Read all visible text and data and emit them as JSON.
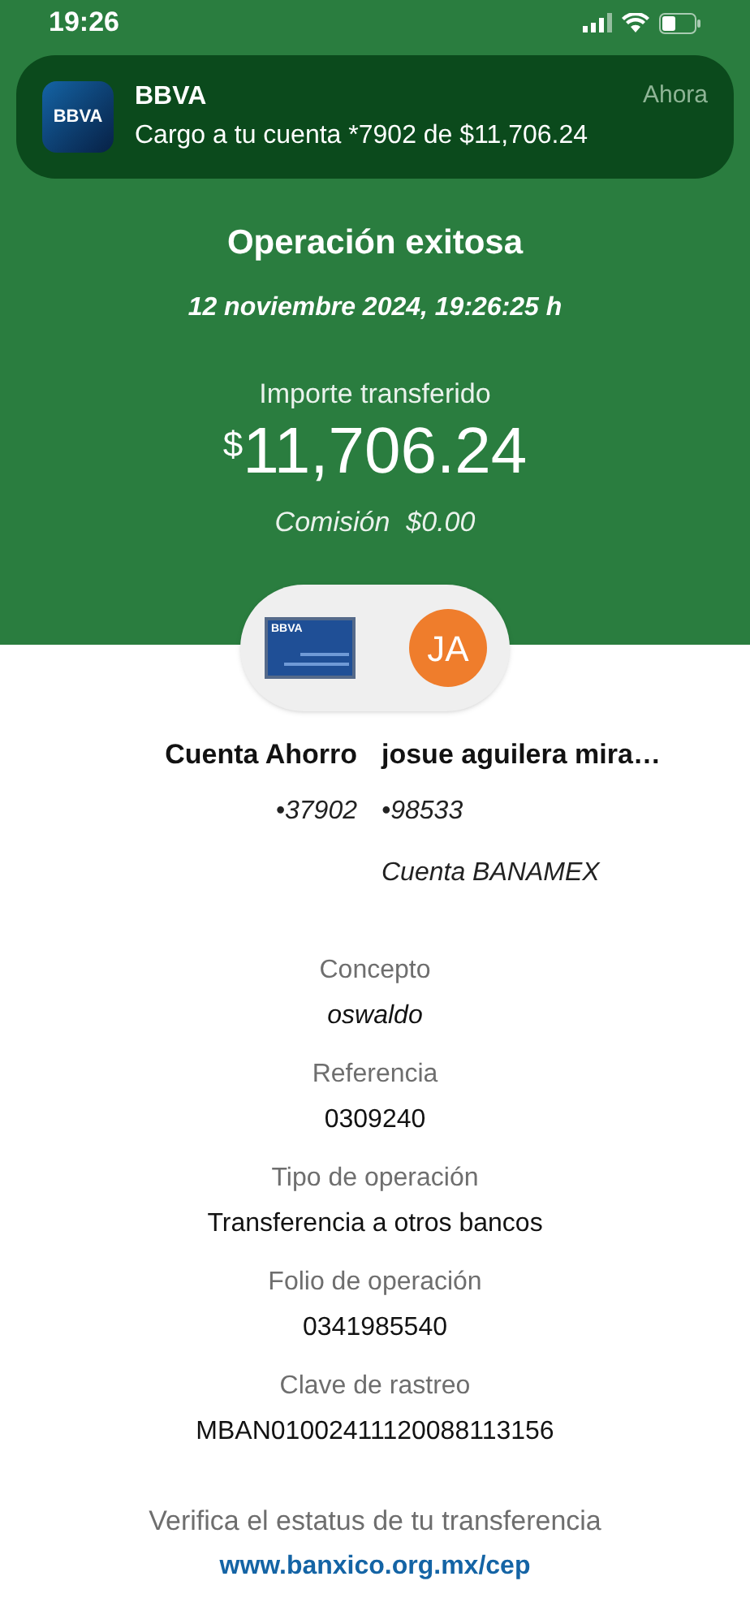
{
  "status_bar": {
    "time": "19:26"
  },
  "notification": {
    "app": "BBVA",
    "time": "Ahora",
    "message": "Cargo a tu cuenta *7902 de $11,706.24",
    "icon_text": "BBVA"
  },
  "header": {
    "title": "Operación exitosa",
    "datetime": "12 noviembre 2024, 19:26:25 h"
  },
  "amount": {
    "label": "Importe transferido",
    "currency": "$",
    "value": "11,706.24",
    "commission_label": "Comisión",
    "commission": "$0.00"
  },
  "accounts": {
    "origin": {
      "name": "Cuenta Ahorro",
      "number": "•37902",
      "card_text": "BBVA"
    },
    "destination": {
      "name": "josue aguilera mira…",
      "number": "•98533",
      "bank": "Cuenta BANAMEX",
      "initials": "JA"
    }
  },
  "details": [
    {
      "label": "Concepto",
      "value": "oswaldo",
      "italic": true
    },
    {
      "label": "Referencia",
      "value": "0309240",
      "italic": false
    },
    {
      "label": "Tipo de operación",
      "value": "Transferencia a otros bancos",
      "italic": false
    },
    {
      "label": "Folio de operación",
      "value": "0341985540",
      "italic": false
    },
    {
      "label": "Clave de rastreo",
      "value": "MBAN01002411120088113156",
      "italic": false
    }
  ],
  "footer": {
    "text": "Verifica el estatus de tu transferencia",
    "link": "www.banxico.org.mx/cep"
  }
}
